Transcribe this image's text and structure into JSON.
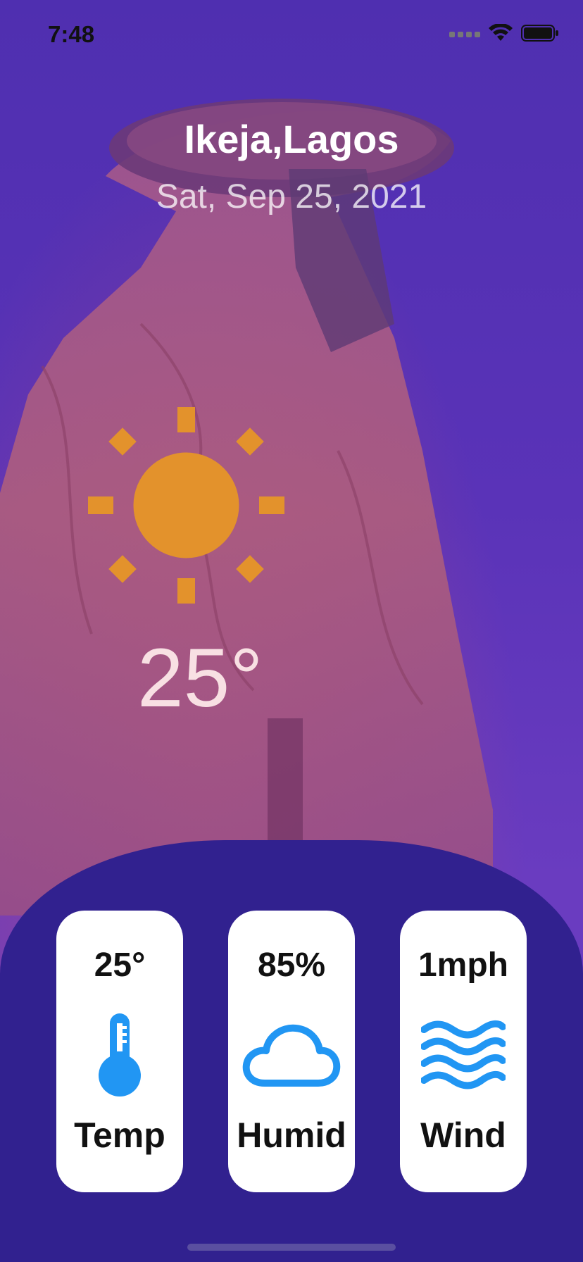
{
  "status_bar": {
    "time": "7:48"
  },
  "header": {
    "location": "Ikeja,Lagos",
    "date": "Sat, Sep 25, 2021"
  },
  "current": {
    "temperature": "25°",
    "condition_icon": "sun-icon"
  },
  "cards": [
    {
      "value": "25°",
      "label": "Temp",
      "icon": "thermometer-icon"
    },
    {
      "value": "85%",
      "label": "Humid",
      "icon": "cloud-icon"
    },
    {
      "value": "1mph",
      "label": "Wind",
      "icon": "waves-icon"
    }
  ],
  "colors": {
    "accent_sun": "#e3922c",
    "card_icon": "#2196f3",
    "sheet": "#31218f"
  }
}
